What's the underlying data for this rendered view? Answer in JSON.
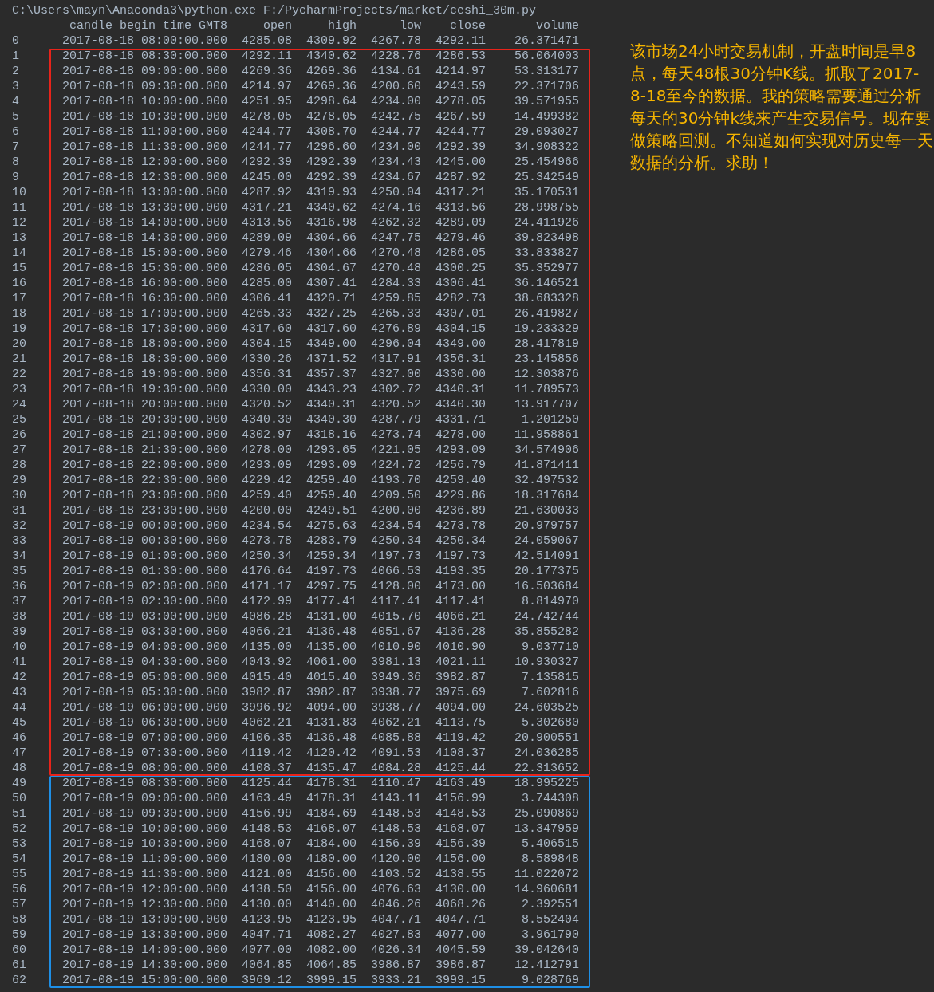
{
  "console": {
    "command": "C:\\Users\\mayn\\Anaconda3\\python.exe F:/PycharmProjects/market/ceshi_30m.py",
    "columns": [
      "candle_begin_time_GMT8",
      "open",
      "high",
      "low",
      "close",
      "volume"
    ],
    "row_groups": [
      {
        "rows": [
          [
            "0",
            "2017-08-18 08:00:00.000",
            "4285.08",
            "4309.92",
            "4267.78",
            "4292.11",
            "26.371471"
          ]
        ]
      },
      {
        "color": "#e8231a",
        "rows": [
          [
            "1",
            "2017-08-18 08:30:00.000",
            "4292.11",
            "4340.62",
            "4228.76",
            "4286.53",
            "56.064003"
          ],
          [
            "2",
            "2017-08-18 09:00:00.000",
            "4269.36",
            "4269.36",
            "4134.61",
            "4214.97",
            "53.313177"
          ],
          [
            "3",
            "2017-08-18 09:30:00.000",
            "4214.97",
            "4269.36",
            "4200.60",
            "4243.59",
            "22.371706"
          ],
          [
            "4",
            "2017-08-18 10:00:00.000",
            "4251.95",
            "4298.64",
            "4234.00",
            "4278.05",
            "39.571955"
          ],
          [
            "5",
            "2017-08-18 10:30:00.000",
            "4278.05",
            "4278.05",
            "4242.75",
            "4267.59",
            "14.499382"
          ],
          [
            "6",
            "2017-08-18 11:00:00.000",
            "4244.77",
            "4308.70",
            "4244.77",
            "4244.77",
            "29.093027"
          ],
          [
            "7",
            "2017-08-18 11:30:00.000",
            "4244.77",
            "4296.60",
            "4234.00",
            "4292.39",
            "34.908322"
          ],
          [
            "8",
            "2017-08-18 12:00:00.000",
            "4292.39",
            "4292.39",
            "4234.43",
            "4245.00",
            "25.454966"
          ],
          [
            "9",
            "2017-08-18 12:30:00.000",
            "4245.00",
            "4292.39",
            "4234.67",
            "4287.92",
            "25.342549"
          ],
          [
            "10",
            "2017-08-18 13:00:00.000",
            "4287.92",
            "4319.93",
            "4250.04",
            "4317.21",
            "35.170531"
          ],
          [
            "11",
            "2017-08-18 13:30:00.000",
            "4317.21",
            "4340.62",
            "4274.16",
            "4313.56",
            "28.998755"
          ],
          [
            "12",
            "2017-08-18 14:00:00.000",
            "4313.56",
            "4316.98",
            "4262.32",
            "4289.09",
            "24.411926"
          ],
          [
            "13",
            "2017-08-18 14:30:00.000",
            "4289.09",
            "4304.66",
            "4247.75",
            "4279.46",
            "39.823498"
          ],
          [
            "14",
            "2017-08-18 15:00:00.000",
            "4279.46",
            "4304.66",
            "4270.48",
            "4286.05",
            "33.833827"
          ],
          [
            "15",
            "2017-08-18 15:30:00.000",
            "4286.05",
            "4304.67",
            "4270.48",
            "4300.25",
            "35.352977"
          ],
          [
            "16",
            "2017-08-18 16:00:00.000",
            "4285.00",
            "4307.41",
            "4284.33",
            "4306.41",
            "36.146521"
          ],
          [
            "17",
            "2017-08-18 16:30:00.000",
            "4306.41",
            "4320.71",
            "4259.85",
            "4282.73",
            "38.683328"
          ],
          [
            "18",
            "2017-08-18 17:00:00.000",
            "4265.33",
            "4327.25",
            "4265.33",
            "4307.01",
            "26.419827"
          ],
          [
            "19",
            "2017-08-18 17:30:00.000",
            "4317.60",
            "4317.60",
            "4276.89",
            "4304.15",
            "19.233329"
          ],
          [
            "20",
            "2017-08-18 18:00:00.000",
            "4304.15",
            "4349.00",
            "4296.04",
            "4349.00",
            "28.417819"
          ],
          [
            "21",
            "2017-08-18 18:30:00.000",
            "4330.26",
            "4371.52",
            "4317.91",
            "4356.31",
            "23.145856"
          ],
          [
            "22",
            "2017-08-18 19:00:00.000",
            "4356.31",
            "4357.37",
            "4327.00",
            "4330.00",
            "12.303876"
          ],
          [
            "23",
            "2017-08-18 19:30:00.000",
            "4330.00",
            "4343.23",
            "4302.72",
            "4340.31",
            "11.789573"
          ],
          [
            "24",
            "2017-08-18 20:00:00.000",
            "4320.52",
            "4340.31",
            "4320.52",
            "4340.30",
            "13.917707"
          ],
          [
            "25",
            "2017-08-18 20:30:00.000",
            "4340.30",
            "4340.30",
            "4287.79",
            "4331.71",
            "1.201250"
          ],
          [
            "26",
            "2017-08-18 21:00:00.000",
            "4302.97",
            "4318.16",
            "4273.74",
            "4278.00",
            "11.958861"
          ],
          [
            "27",
            "2017-08-18 21:30:00.000",
            "4278.00",
            "4293.65",
            "4221.05",
            "4293.09",
            "34.574906"
          ],
          [
            "28",
            "2017-08-18 22:00:00.000",
            "4293.09",
            "4293.09",
            "4224.72",
            "4256.79",
            "41.871411"
          ],
          [
            "29",
            "2017-08-18 22:30:00.000",
            "4229.42",
            "4259.40",
            "4193.70",
            "4259.40",
            "32.497532"
          ],
          [
            "30",
            "2017-08-18 23:00:00.000",
            "4259.40",
            "4259.40",
            "4209.50",
            "4229.86",
            "18.317684"
          ],
          [
            "31",
            "2017-08-18 23:30:00.000",
            "4200.00",
            "4249.51",
            "4200.00",
            "4236.89",
            "21.630033"
          ],
          [
            "32",
            "2017-08-19 00:00:00.000",
            "4234.54",
            "4275.63",
            "4234.54",
            "4273.78",
            "20.979757"
          ],
          [
            "33",
            "2017-08-19 00:30:00.000",
            "4273.78",
            "4283.79",
            "4250.34",
            "4250.34",
            "24.059067"
          ],
          [
            "34",
            "2017-08-19 01:00:00.000",
            "4250.34",
            "4250.34",
            "4197.73",
            "4197.73",
            "42.514091"
          ],
          [
            "35",
            "2017-08-19 01:30:00.000",
            "4176.64",
            "4197.73",
            "4066.53",
            "4193.35",
            "20.177375"
          ],
          [
            "36",
            "2017-08-19 02:00:00.000",
            "4171.17",
            "4297.75",
            "4128.00",
            "4173.00",
            "16.503684"
          ],
          [
            "37",
            "2017-08-19 02:30:00.000",
            "4172.99",
            "4177.41",
            "4117.41",
            "4117.41",
            "8.814970"
          ],
          [
            "38",
            "2017-08-19 03:00:00.000",
            "4086.28",
            "4131.00",
            "4015.70",
            "4066.21",
            "24.742744"
          ],
          [
            "39",
            "2017-08-19 03:30:00.000",
            "4066.21",
            "4136.48",
            "4051.67",
            "4136.28",
            "35.855282"
          ],
          [
            "40",
            "2017-08-19 04:00:00.000",
            "4135.00",
            "4135.00",
            "4010.90",
            "4010.90",
            "9.037710"
          ],
          [
            "41",
            "2017-08-19 04:30:00.000",
            "4043.92",
            "4061.00",
            "3981.13",
            "4021.11",
            "10.930327"
          ],
          [
            "42",
            "2017-08-19 05:00:00.000",
            "4015.40",
            "4015.40",
            "3949.36",
            "3982.87",
            "7.135815"
          ],
          [
            "43",
            "2017-08-19 05:30:00.000",
            "3982.87",
            "3982.87",
            "3938.77",
            "3975.69",
            "7.602816"
          ],
          [
            "44",
            "2017-08-19 06:00:00.000",
            "3996.92",
            "4094.00",
            "3938.77",
            "4094.00",
            "24.603525"
          ],
          [
            "45",
            "2017-08-19 06:30:00.000",
            "4062.21",
            "4131.83",
            "4062.21",
            "4113.75",
            "5.302680"
          ],
          [
            "46",
            "2017-08-19 07:00:00.000",
            "4106.35",
            "4136.48",
            "4085.88",
            "4119.42",
            "20.900551"
          ],
          [
            "47",
            "2017-08-19 07:30:00.000",
            "4119.42",
            "4120.42",
            "4091.53",
            "4108.37",
            "24.036285"
          ],
          [
            "48",
            "2017-08-19 08:00:00.000",
            "4108.37",
            "4135.47",
            "4084.28",
            "4125.44",
            "22.313652"
          ]
        ]
      },
      {
        "color": "#1e8fe6",
        "rows": [
          [
            "49",
            "2017-08-19 08:30:00.000",
            "4125.44",
            "4178.31",
            "4110.47",
            "4163.49",
            "18.995225"
          ],
          [
            "50",
            "2017-08-19 09:00:00.000",
            "4163.49",
            "4178.31",
            "4143.11",
            "4156.99",
            "3.744308"
          ],
          [
            "51",
            "2017-08-19 09:30:00.000",
            "4156.99",
            "4184.69",
            "4148.53",
            "4148.53",
            "25.090869"
          ],
          [
            "52",
            "2017-08-19 10:00:00.000",
            "4148.53",
            "4168.07",
            "4148.53",
            "4168.07",
            "13.347959"
          ],
          [
            "53",
            "2017-08-19 10:30:00.000",
            "4168.07",
            "4184.00",
            "4156.39",
            "4156.39",
            "5.406515"
          ],
          [
            "54",
            "2017-08-19 11:00:00.000",
            "4180.00",
            "4180.00",
            "4120.00",
            "4156.00",
            "8.589848"
          ],
          [
            "55",
            "2017-08-19 11:30:00.000",
            "4121.00",
            "4156.00",
            "4103.52",
            "4138.55",
            "11.022072"
          ],
          [
            "56",
            "2017-08-19 12:00:00.000",
            "4138.50",
            "4156.00",
            "4076.63",
            "4130.00",
            "14.960681"
          ],
          [
            "57",
            "2017-08-19 12:30:00.000",
            "4130.00",
            "4140.00",
            "4046.26",
            "4068.26",
            "2.392551"
          ],
          [
            "58",
            "2017-08-19 13:00:00.000",
            "4123.95",
            "4123.95",
            "4047.71",
            "4047.71",
            "8.552404"
          ],
          [
            "59",
            "2017-08-19 13:30:00.000",
            "4047.71",
            "4082.27",
            "4027.83",
            "4077.00",
            "3.961790"
          ],
          [
            "60",
            "2017-08-19 14:00:00.000",
            "4077.00",
            "4082.00",
            "4026.34",
            "4045.59",
            "39.042640"
          ],
          [
            "61",
            "2017-08-19 14:30:00.000",
            "4064.85",
            "4064.85",
            "3986.87",
            "3986.87",
            "12.412791"
          ],
          [
            "62",
            "2017-08-19 15:00:00.000",
            "3969.12",
            "3999.15",
            "3933.21",
            "3999.15",
            "9.028769"
          ]
        ]
      }
    ]
  },
  "note": "该市场24小时交易机制，开盘时间是早8点，每天48根30分钟K线。抓取了2017-8-18至今的数据。我的策略需要通过分析每天的30分钟k线来产生交易信号。现在要做策略回测。不知道如何实现对历史每一天数据的分析。求助！"
}
